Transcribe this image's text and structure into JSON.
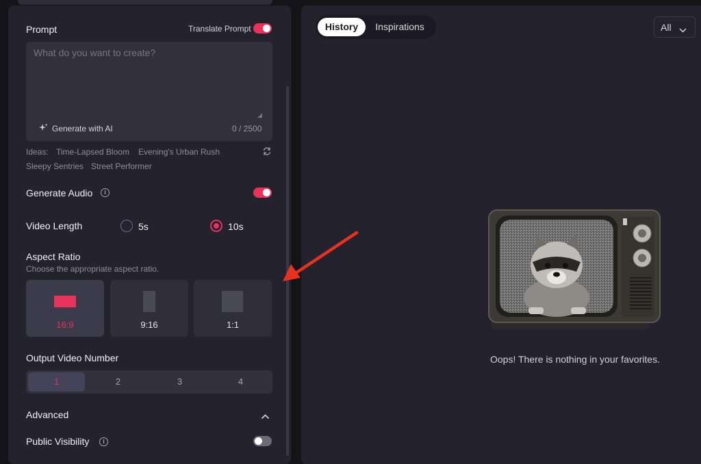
{
  "prompt": {
    "label": "Prompt",
    "translate_label": "Translate Prompt",
    "translate_on": true,
    "placeholder": "What do you want to create?",
    "value": "",
    "generate_ai_label": "Generate with AI",
    "counter": "0 / 2500"
  },
  "ideas": {
    "label": "Ideas:",
    "items": [
      "Time-Lapsed Bloom",
      "Evening's Urban Rush",
      "Sleepy Sentries",
      "Street Performer"
    ]
  },
  "audio": {
    "label": "Generate Audio",
    "on": true
  },
  "video_length": {
    "label": "Video Length",
    "options": [
      "5s",
      "10s"
    ],
    "selected": "10s"
  },
  "aspect_ratio": {
    "label": "Aspect Ratio",
    "hint": "Choose the appropriate aspect ratio.",
    "options": [
      "16:9",
      "9:16",
      "1:1"
    ],
    "selected": "16:9"
  },
  "output_number": {
    "label": "Output Video Number",
    "options": [
      "1",
      "2",
      "3",
      "4"
    ],
    "selected": "1"
  },
  "advanced": {
    "label": "Advanced"
  },
  "public_visibility": {
    "label": "Public Visibility",
    "on": false
  },
  "tabs": {
    "history": "History",
    "inspirations": "Inspirations",
    "active": "History"
  },
  "filter": {
    "value": "All"
  },
  "empty_state": {
    "message": "Oops! There is nothing in your favorites."
  },
  "colors": {
    "accent": "#e8335d",
    "panel": "#24232d",
    "background": "#141418",
    "arrow": "#e8321f"
  }
}
